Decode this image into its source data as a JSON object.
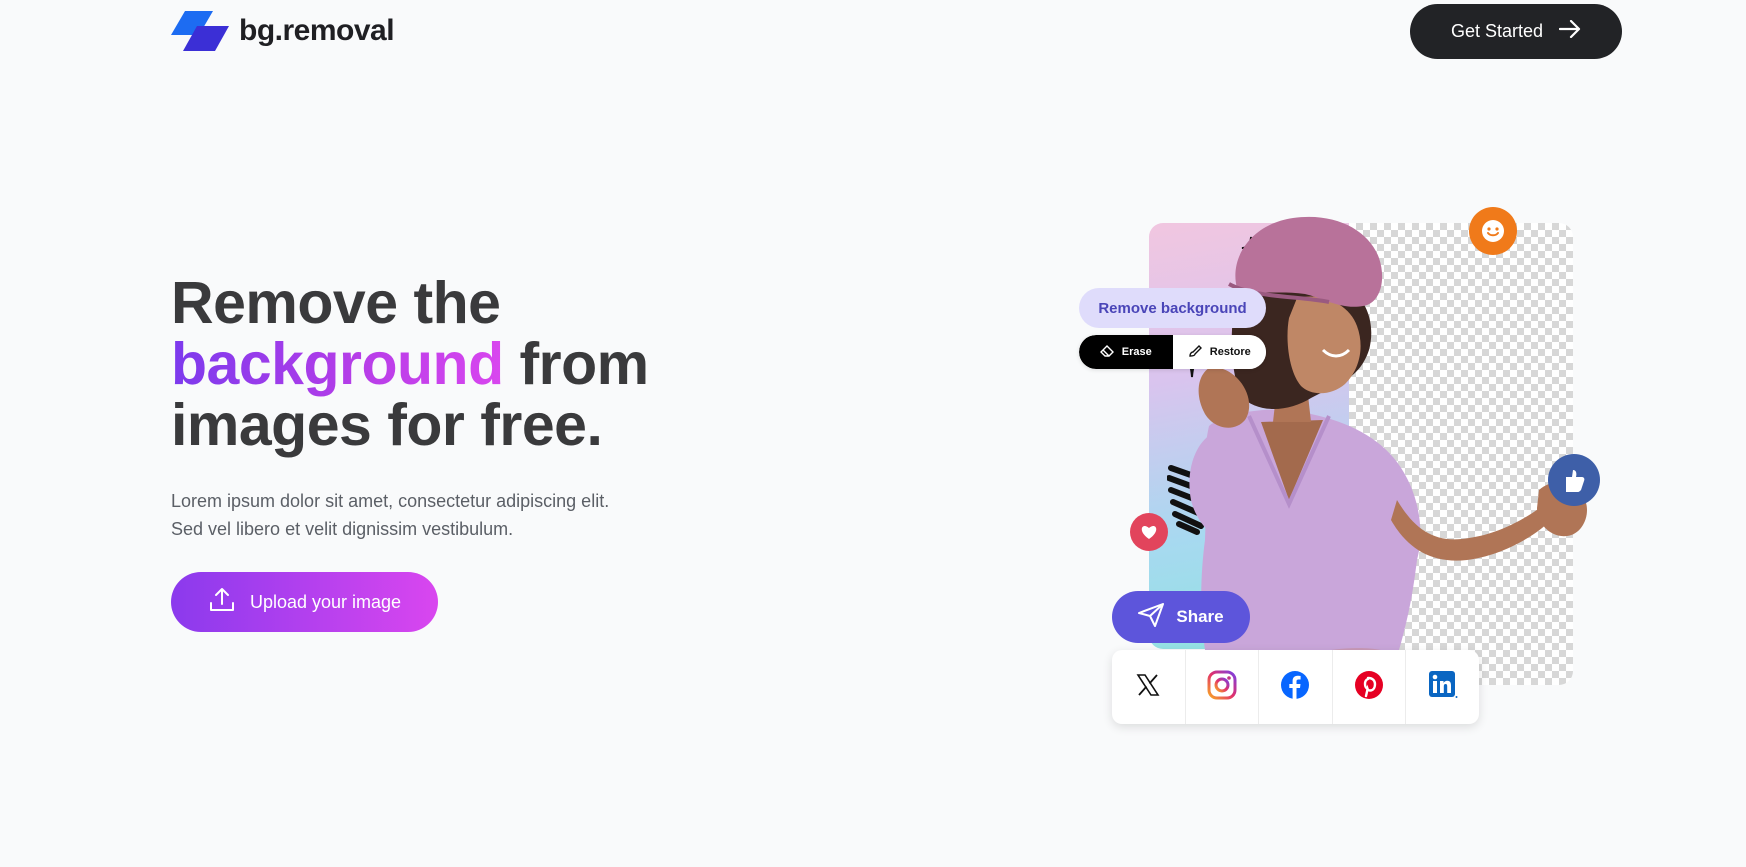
{
  "header": {
    "logo_text": "bg.removal",
    "cta_label": "Get Started"
  },
  "hero": {
    "title_line1": "Remove the",
    "title_highlight": "background",
    "title_line2_rest": " from",
    "title_line3": "images for free.",
    "desc_line1": "Lorem ipsum dolor sit amet, consectetur adipiscing elit.",
    "desc_line2": "Sed vel libero et velit dignissim vestibulum.",
    "upload_label": "Upload your image"
  },
  "editor": {
    "remove_bg_label": "Remove background",
    "erase_label": "Erase",
    "restore_label": "Restore",
    "share_label": "Share",
    "socials": [
      "x-icon",
      "instagram-icon",
      "facebook-icon",
      "pinterest-icon",
      "linkedin-icon"
    ]
  },
  "colors": {
    "accent_start": "#7c3aed",
    "accent_end": "#d946ef",
    "dark": "#222326",
    "share": "#5d55db",
    "pill_bg": "#dfdcfb"
  }
}
